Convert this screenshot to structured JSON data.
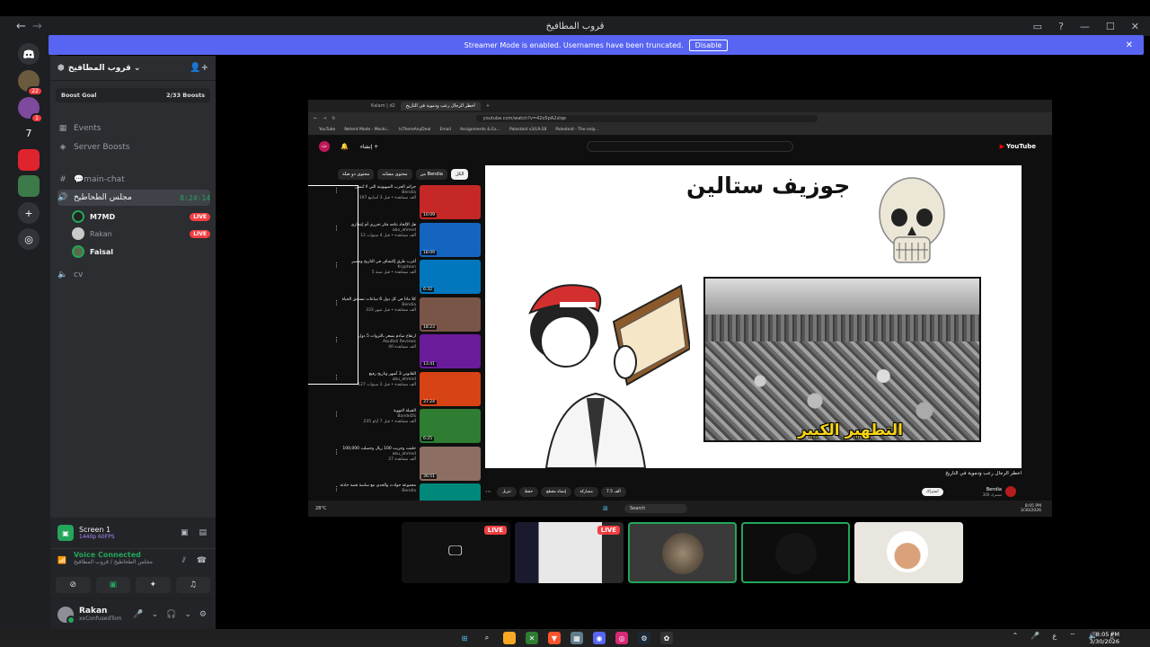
{
  "window": {
    "title": "قروب المطافيخ"
  },
  "banner": {
    "text": "Streamer Mode is enabled. Usernames have been truncated.",
    "button": "Disable"
  },
  "servers": [
    {
      "label": "",
      "badge": "22",
      "color": "#6b5b3e"
    },
    {
      "label": "",
      "badge": "1",
      "color": "#7d4a9e"
    },
    {
      "label": "7",
      "badge": "",
      "color": "#1e1f22"
    },
    {
      "label": "",
      "badge": "",
      "color": "#e0242d"
    },
    {
      "label": "",
      "badge": "",
      "color": "#3d7a4a"
    },
    {
      "label": "+",
      "badge": "",
      "color": "#313338"
    },
    {
      "label": "◎",
      "badge": "",
      "color": "#313338"
    }
  ],
  "guild": {
    "name": "قروب المطافيخ",
    "boost_goal": "Boost Goal",
    "boost_count": "2/33 Boosts"
  },
  "channels": {
    "events": "Events",
    "server_boosts": "Server Boosts",
    "main_chat": "💬main-chat",
    "voice_channel": "مجلس الطحاطيخ",
    "voice_time": "8:24:14",
    "voice_users": [
      {
        "name": "M7MD",
        "live": "LIVE"
      },
      {
        "name": "Rakan",
        "live": "LIVE"
      },
      {
        "name": "Faisal",
        "live": ""
      }
    ],
    "cv": "cv"
  },
  "panel": {
    "screen_title": "Screen 1",
    "screen_sub": "1440p 60FPS",
    "voice_status": "Voice Connected",
    "voice_location": "مجلس الطحاطيخ / قروب المطافيخ",
    "user_name": "Rakan",
    "user_status": "xxConfusedTom"
  },
  "browser": {
    "tabs": [
      "Kalam | d2",
      "اخطر الرجال رعب ودموية في التاريخ"
    ],
    "url": "youtube.com/watch?v=42o5pA2xlqe",
    "bookmarks": [
      "YouTube",
      "Netent Mode - Mocki...",
      "IsThereAnyDeal",
      "Email",
      "Assignments & Ex...",
      "Palestoid v3/L9-28",
      "Palestoid - The only..."
    ]
  },
  "youtube": {
    "logo": "YouTube",
    "create": "إنشاء",
    "chips": [
      "الكل",
      "من Bendia",
      "محتوى مشابه",
      "محتوى ذو صلة"
    ],
    "recs": [
      {
        "title": "جرائم الحرب الصهيونية التي لا تُنسى",
        "channel": "Bendia",
        "meta": "197 ألف مشاهدة • قبل 3 أسابيع",
        "dur": "10:09",
        "color": "#c62828"
      },
      {
        "title": "هل الإلحاد نتاجه فكر تحرري أم إنتحاري",
        "channel": "abo_ahmed",
        "meta": "12 ألف مشاهدة • قبل 4 سنوات",
        "dur": "18:09",
        "color": "#1565c0"
      },
      {
        "title": "أغرب طرق إكتشاف في التاريخ ومصير",
        "channel": "Kryptoon",
        "meta": "5 ألف مشاهدة • قبل سنة",
        "dur": "6:32",
        "color": "#0277bd"
      },
      {
        "title": "كلا ماذا في كل دول 6 ساعات تستحق الحياة",
        "channel": "Bendia",
        "meta": "333 ألف مشاهدة • قبل شهر",
        "dur": "18:23",
        "color": "#795548"
      },
      {
        "title": "ارتفاع صادم بسعر بالثروات 5 دول",
        "channel": "AbuBali Reviews",
        "meta": "40 ألف مشاهدة",
        "dur": "13:41",
        "color": "#6a1b9a"
      },
      {
        "title": "القانوني 3 أشهر وتاريخ رفيع",
        "channel": "abu_ahmed",
        "meta": "127 ألف مشاهدة • قبل 3 سنوات",
        "dur": "37:24",
        "color": "#d84315"
      },
      {
        "title": "القنبلة النووية",
        "channel": "BandeDS",
        "meta": "235 ألف مشاهدة • قبل 7 أيام",
        "dur": "6:25",
        "color": "#2e7d32"
      },
      {
        "title": "حلمت وجربت 100 ريال وحصلت 100,000",
        "channel": "abu_ahmed",
        "meta": "27 ألف مشاهدة",
        "dur": "36:51",
        "color": "#8d6e63"
      },
      {
        "title": "مجموعة حوادث والحدي مع ساسة قصة حادثة",
        "channel": "Bendia",
        "meta": "",
        "dur": "",
        "color": "#00897b"
      }
    ],
    "video_overlay_title": "جوزيف ستالين",
    "video_overlay_caption": "التطهير الكبير",
    "video_title": "اخطر الرجال رعب ودموية في التاريخ",
    "channel": "Bendia",
    "subscribers": "300 مشترك",
    "subscribe": "اشتراك",
    "actions": [
      "7.5 ألف",
      "مشاركة",
      "إنشاء مقطع",
      "حفظ",
      "تنزيل"
    ]
  },
  "guest_taskbar": {
    "weather": "28°C",
    "search": "Search",
    "time": "8:05 PM",
    "date": "3/30/2026"
  },
  "tiles": [
    {
      "live": "LIVE"
    },
    {
      "live": "LIVE"
    },
    {
      "live": ""
    },
    {
      "live": ""
    },
    {
      "live": ""
    }
  ],
  "taskbar": {
    "time": "8:05 PM",
    "date": "3/30/2026",
    "lang": "ع"
  }
}
